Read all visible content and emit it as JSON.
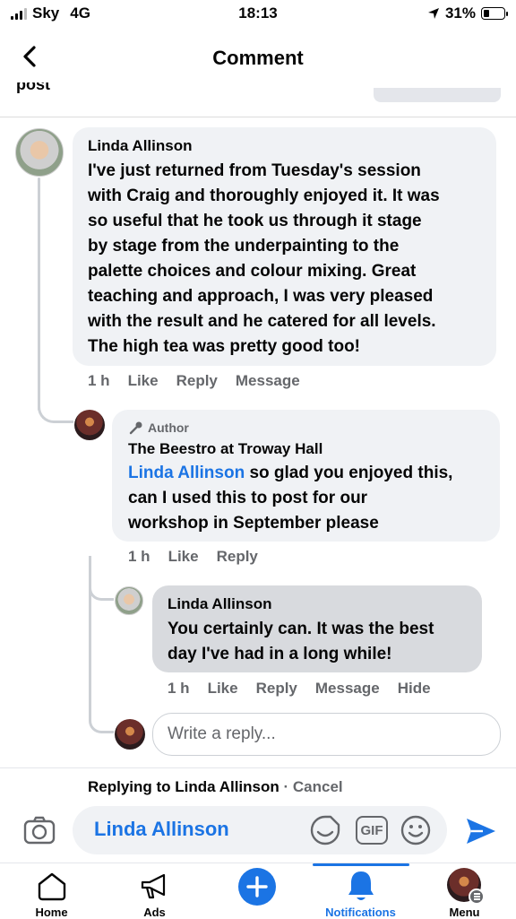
{
  "status_bar": {
    "carrier": "Sky",
    "network": "4G",
    "time": "18:13",
    "battery": "31%",
    "battery_level": 0.31
  },
  "header": {
    "title": "Comment"
  },
  "post_peek": "post",
  "comment": {
    "author": "Linda Allinson",
    "text": "I've just returned from Tuesday's session with Craig and thoroughly enjoyed it. It was so useful that he took us through it stage by stage from the underpainting to the palette choices and colour mixing. Great teaching and approach, I was very pleased with the result and he catered for all levels. The high tea was pretty good too!",
    "lines": [
      "I've just returned from Tuesday's session",
      "with Craig and thoroughly enjoyed it. It was",
      "so useful that he took us through it stage",
      "by stage from the underpainting to the",
      "palette choices and colour mixing. Great",
      "teaching and approach, I was very pleased",
      "with the result and he catered for all levels.",
      "The high tea was pretty good too!"
    ],
    "time": "1 h",
    "like": "Like",
    "reply": "Reply",
    "message": "Message"
  },
  "author_reply": {
    "badge": "Author",
    "author": "The Beestro at Troway Hall",
    "mention": "Linda Allinson",
    "line1_rest": " so glad you enjoyed this,",
    "line2": "can I used this to post for our",
    "line3": "workshop in September please",
    "time": "1 h",
    "like": "Like",
    "reply": "Reply"
  },
  "nested_reply": {
    "author": "Linda Allinson",
    "line1": "You certainly can. It was the best",
    "line2": "day I've had in a long while!",
    "time": "1 h",
    "like": "Like",
    "reply": "Reply",
    "message": "Message",
    "hide": "Hide"
  },
  "reply_input": {
    "placeholder": "Write a reply..."
  },
  "replying_bar": {
    "prefix": "Replying to ",
    "name": "Linda Allinson",
    "separator": " · ",
    "cancel": "Cancel"
  },
  "composer": {
    "text": "Linda Allinson",
    "gif_label": "GIF"
  },
  "nav": {
    "items": [
      {
        "label": "Home",
        "icon": "home-icon"
      },
      {
        "label": "Ads",
        "icon": "megaphone-icon"
      },
      {
        "label": "",
        "icon": "plus-icon"
      },
      {
        "label": "Notifications",
        "icon": "bell-icon"
      },
      {
        "label": "Menu",
        "icon": "menu-avatar-icon"
      }
    ]
  },
  "colors": {
    "accent": "#1b74e4",
    "bubble": "#f0f2f5",
    "bubble_selected": "#d8dade",
    "secondary_text": "#65676b"
  }
}
